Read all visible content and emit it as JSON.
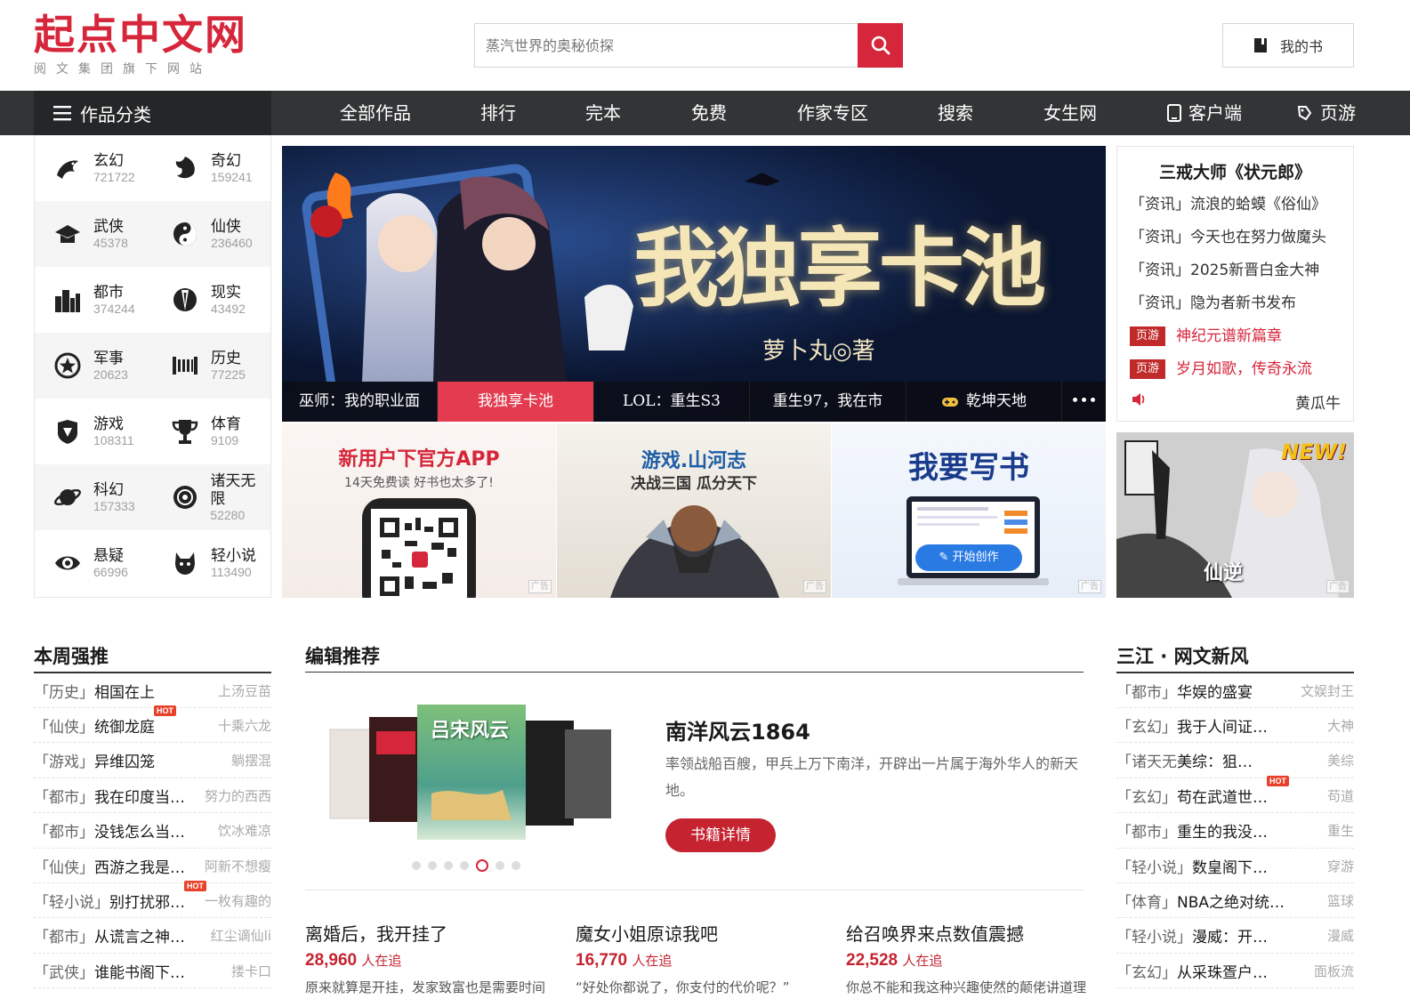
{
  "logo": {
    "main": "起点中文网",
    "sub": "阅文集团旗下网站"
  },
  "search": {
    "placeholder": "蒸汽世界的奥秘侦探"
  },
  "header": {
    "mybook_label": "我的书"
  },
  "nav": {
    "category_label": "作品分类",
    "items": [
      "全部作品",
      "排行",
      "完本",
      "免费",
      "作家专区",
      "搜索",
      "女生网",
      "客户端",
      "页游"
    ]
  },
  "categories": [
    {
      "name": "玄幻",
      "count": "721722",
      "icon": "dragon-icon"
    },
    {
      "name": "奇幻",
      "count": "159241",
      "icon": "wyvern-icon"
    },
    {
      "name": "武侠",
      "count": "45378",
      "icon": "hat-icon"
    },
    {
      "name": "仙侠",
      "count": "236460",
      "icon": "taiji-icon"
    },
    {
      "name": "都市",
      "count": "374244",
      "icon": "city-icon"
    },
    {
      "name": "现实",
      "count": "43492",
      "icon": "suit-icon"
    },
    {
      "name": "军事",
      "count": "20623",
      "icon": "star-badge-icon"
    },
    {
      "name": "历史",
      "count": "77225",
      "icon": "scroll-icon"
    },
    {
      "name": "游戏",
      "count": "108311",
      "icon": "helmet-icon"
    },
    {
      "name": "体育",
      "count": "9109",
      "icon": "trophy-icon"
    },
    {
      "name": "科幻",
      "count": "157333",
      "icon": "planet-icon"
    },
    {
      "name": "诸天无限",
      "count": "52280",
      "icon": "orbit-icon"
    },
    {
      "name": "悬疑",
      "count": "66996",
      "icon": "eye-icon"
    },
    {
      "name": "轻小说",
      "count": "113490",
      "icon": "cat-icon"
    }
  ],
  "banner": {
    "title": "我独享卡池",
    "author": "萝卜丸◎著",
    "tabs": [
      "巫师：我的职业面",
      "我独享卡池",
      "LOL：重生S3",
      "重生97，我在市",
      "乾坤天地",
      "•••"
    ],
    "active_tab": 1
  },
  "news": {
    "headline": "三戒大师《状元郎》",
    "items": [
      "「资讯」流浪的蛤蟆《俗仙》",
      "「资讯」今天也在努力做魔头",
      "「资讯」2025新晋白金大神",
      "「资讯」隐为者新书发布"
    ],
    "game_items": [
      {
        "tag": "页游",
        "text": "神纪元谱新篇章"
      },
      {
        "tag": "页游",
        "text": "岁月如歌，传奇永流"
      }
    ],
    "footer_right": "黄瓜牛"
  },
  "ads": [
    {
      "title": "新用户下官方APP",
      "sub": "14天免费读 好书也太多了!",
      "mark": "广告"
    },
    {
      "title": "游戏.山河志",
      "sub": "决战三国 瓜分天下",
      "mark": "广告"
    },
    {
      "title": "我要写书",
      "button": "开始创作",
      "mark": "广告"
    },
    {
      "new": "NEW!",
      "title": "仙逆",
      "mark": "广告"
    }
  ],
  "weekly": {
    "title": "本周强推",
    "rows": [
      {
        "cat": "「历史」",
        "book": "相国在上",
        "author": "上汤豆苗",
        "hot": false
      },
      {
        "cat": "「仙侠」",
        "book": "统御龙庭",
        "author": "十乘六龙",
        "hot": true
      },
      {
        "cat": "「游戏」",
        "book": "异维囚笼",
        "author": "躺摆混",
        "hot": false
      },
      {
        "cat": "「都市」",
        "book": "我在印度当…",
        "author": "努力的西西",
        "hot": false
      },
      {
        "cat": "「都市」",
        "book": "没钱怎么当…",
        "author": "饮冰难凉",
        "hot": false
      },
      {
        "cat": "「仙侠」",
        "book": "西游之我是…",
        "author": "阿新不想瘦",
        "hot": false
      },
      {
        "cat": "「轻小说」",
        "book": "别打扰邪…",
        "author": "一枚有趣的",
        "hot": true
      },
      {
        "cat": "「都市」",
        "book": "从谎言之神…",
        "author": "红尘谪仙li",
        "hot": false
      },
      {
        "cat": "「武侠」",
        "book": "谁能书阁下…",
        "author": "搂卡口",
        "hot": false
      }
    ]
  },
  "editor": {
    "title": "编辑推荐",
    "book": "南洋风云1864",
    "desc": "率领战船百艘，甲兵上万下南洋，开辟出一片属于海外华人的新天地。",
    "button": "书籍详情",
    "cover_text": "吕宋风云",
    "bottom": [
      {
        "title": "离婚后，我开挂了",
        "count": "28,960",
        "unit": "人在追",
        "desc": "原来就算是开挂，发家致富也是需要时间"
      },
      {
        "title": "魔女小姐原谅我吧",
        "count": "16,770",
        "unit": "人在追",
        "desc": "“好处你都说了，你支付的代价呢？”"
      },
      {
        "title": "给召唤界来点数值震撼",
        "count": "22,528",
        "unit": "人在追",
        "desc": "你总不能和我这种兴趣使然的颠佬讲道理"
      }
    ]
  },
  "sanjiang": {
    "title": "三江 · 网文新风",
    "rows": [
      {
        "cat": "「都市」",
        "book": "华娱的盛宴",
        "author": "文娱封王",
        "hot": false
      },
      {
        "cat": "「玄幻」",
        "book": "我于人间证…",
        "author": "大神",
        "hot": false
      },
      {
        "cat": "「诸天无",
        "book": "美综：狙…",
        "author": "美综",
        "hot": false
      },
      {
        "cat": "「玄幻」",
        "book": "苟在武道世…",
        "author": "苟道",
        "hot": true
      },
      {
        "cat": "「都市」",
        "book": "重生的我没…",
        "author": "重生",
        "hot": false
      },
      {
        "cat": "「轻小说」",
        "book": "数皇阁下…",
        "author": "穿游",
        "hot": false
      },
      {
        "cat": "「体育」",
        "book": "NBA之绝对统…",
        "author": "篮球",
        "hot": false
      },
      {
        "cat": "「轻小说」",
        "book": "漫威：开…",
        "author": "漫威",
        "hot": false
      },
      {
        "cat": "「玄幻」",
        "book": "从采珠疍户…",
        "author": "面板流",
        "hot": false
      }
    ]
  },
  "colors": {
    "brand_red": "#d6263b",
    "nav_bg": "#333436",
    "active_tab": "#e33c50"
  }
}
